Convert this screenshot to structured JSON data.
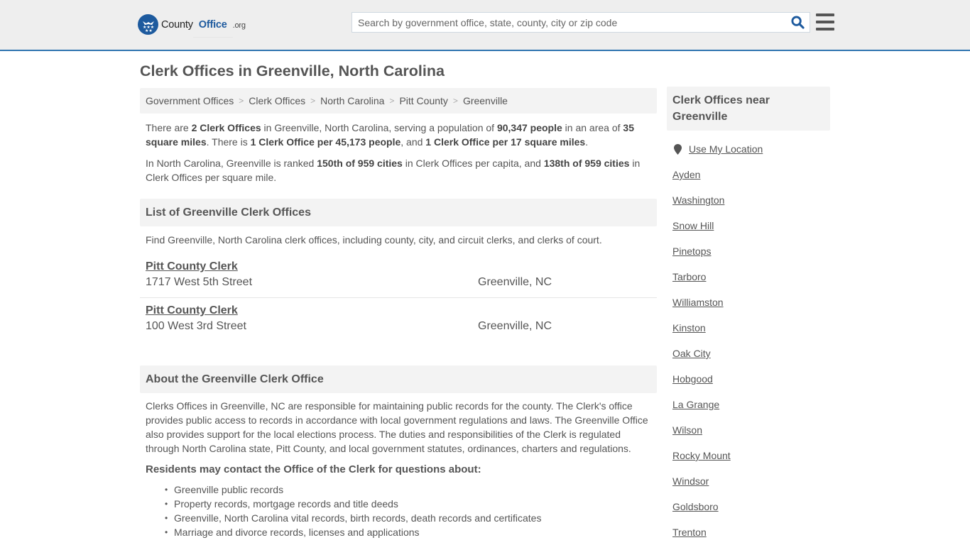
{
  "header": {
    "logo": {
      "county": "County",
      "office": "Office",
      "org": ".org",
      "icon": "eagle-stars-icon"
    },
    "search": {
      "placeholder": "Search by government office, state, county, city or zip code",
      "value": "",
      "icon": "search-icon"
    },
    "menu_icon": "hamburger-menu-icon",
    "accent_color": "#2f75b0",
    "brand_color": "#1d5a9e"
  },
  "page": {
    "title": "Clerk Offices in Greenville, North Carolina"
  },
  "breadcrumb": [
    {
      "label": "Government Offices"
    },
    {
      "label": "Clerk Offices"
    },
    {
      "label": "North Carolina"
    },
    {
      "label": "Pitt County"
    },
    {
      "label": "Greenville"
    }
  ],
  "summary": {
    "p1": {
      "t1": "There are ",
      "b1": "2 Clerk Offices",
      "t2": " in Greenville, North Carolina, serving a population of ",
      "b2": "90,347 people",
      "t3": " in an area of ",
      "b3": "35 square miles",
      "t4": ". There is ",
      "b4": "1 Clerk Office per 45,173 people",
      "t5": ", and ",
      "b5": "1 Clerk Office per 17 square miles",
      "t6": "."
    },
    "p2": {
      "t1": "In North Carolina, Greenville is ranked ",
      "b1": "150th of 959 cities",
      "t2": " in Clerk Offices per capita, and ",
      "b2": "138th of 959 cities",
      "t3": " in Clerk Offices per square mile."
    }
  },
  "list": {
    "heading": "List of Greenville Clerk Offices",
    "intro": "Find Greenville, North Carolina clerk offices, including county, city, and circuit clerks, and clerks of court.",
    "offices": [
      {
        "name": "Pitt County Clerk",
        "address": "1717 West 5th Street",
        "city": "Greenville, NC"
      },
      {
        "name": "Pitt County Clerk",
        "address": "100 West 3rd Street",
        "city": "Greenville, NC"
      }
    ]
  },
  "about": {
    "heading": "About the Greenville Clerk Office",
    "body": "Clerks Offices in Greenville, NC are responsible for maintaining public records for the county. The Clerk's office provides public access to records in accordance with local government regulations and laws. The Greenville Office also provides support for the local elections process. The duties and responsibilities of the Clerk is regulated through North Carolina state, Pitt County, and local government statutes, ordinances, charters and regulations.",
    "subheading": "Residents may contact the Office of the Clerk for questions about:",
    "items": [
      "Greenville public records",
      "Property records, mortgage records and title deeds",
      "Greenville, North Carolina vital records, birth records, death records and certificates",
      "Marriage and divorce records, licenses and applications"
    ]
  },
  "sidebar": {
    "heading": "Clerk Offices near Greenville",
    "use_location": "Use My Location",
    "location_icon": "map-pin-icon",
    "cities": [
      "Ayden",
      "Washington",
      "Snow Hill",
      "Pinetops",
      "Tarboro",
      "Williamston",
      "Kinston",
      "Oak City",
      "Hobgood",
      "La Grange",
      "Wilson",
      "Rocky Mount",
      "Windsor",
      "Goldsboro",
      "Trenton"
    ]
  }
}
